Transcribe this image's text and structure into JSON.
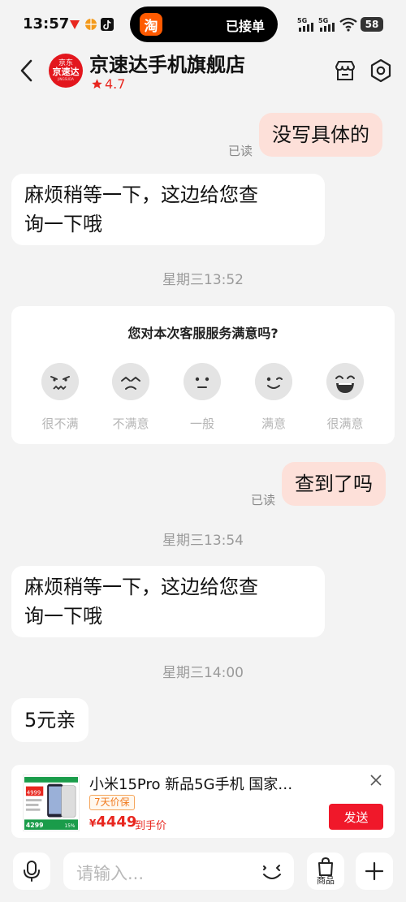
{
  "status_bar": {
    "time": "13:57",
    "island_text": "已接单",
    "app_badge": "淘",
    "network_1": "5G",
    "network_2": "5G",
    "battery": "58"
  },
  "header": {
    "shop_name": "京速达手机旗舰店",
    "rating": "4.7",
    "logo_top": "京东",
    "logo_main": "京速达",
    "logo_sub": "JINGSUDA"
  },
  "messages": [
    {
      "side": "right",
      "text": "没写具体的",
      "read": "已读"
    },
    {
      "side": "left",
      "text_line1": "麻烦稍等一下，这边给您查",
      "text_line2": "询一下哦"
    },
    {
      "timestamp": "星期三13:52"
    },
    {
      "side": "right",
      "text": "查到了吗",
      "read": "已读"
    },
    {
      "timestamp": "星期三13:54"
    },
    {
      "side": "left",
      "text_line1": "麻烦稍等一下，这边给您查",
      "text_line2": "询一下哦"
    },
    {
      "timestamp": "星期三14:00"
    },
    {
      "side": "left",
      "text": "5元亲"
    }
  ],
  "survey": {
    "question": "您对本次客服服务满意吗?",
    "options": [
      {
        "label": "很不满",
        "icon": "very-unsatisfied-face-icon"
      },
      {
        "label": "不满意",
        "icon": "unsatisfied-face-icon"
      },
      {
        "label": "一般",
        "icon": "neutral-face-icon"
      },
      {
        "label": "满意",
        "icon": "satisfied-face-icon"
      },
      {
        "label": "很满意",
        "icon": "very-satisfied-face-icon"
      }
    ]
  },
  "product": {
    "title": "小米15Pro 新品5G手机 国家…",
    "tag": "7天价保",
    "currency": "¥",
    "price": "4449",
    "price_note": "到手价",
    "send_label": "发送",
    "thumb_price_a": "4999",
    "thumb_price_b": "4299",
    "thumb_pct": "15%"
  },
  "input_bar": {
    "placeholder": "请输入...",
    "goods_label": "商品"
  },
  "colors": {
    "accent": "#e8271f",
    "bubble_right": "#fde0d9",
    "send_button": "#f0182a"
  }
}
